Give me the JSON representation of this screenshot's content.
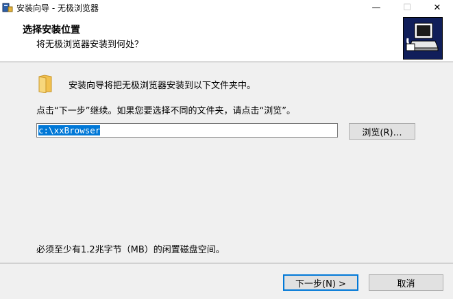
{
  "window": {
    "title": "安装向导 - 无极浏览器",
    "minimize_glyph": "—",
    "maximize_glyph": "☐",
    "close_glyph": "✕"
  },
  "header": {
    "title": "选择安装位置",
    "subtitle": "将无极浏览器安装到何处？",
    "logo_icon": "computer-install-icon"
  },
  "body": {
    "folder_icon": "folder-icon",
    "intro_text": "安装向导将把无极浏览器安装到以下文件夹中。",
    "instruction_text": "点击“下一步”继续。如果您要选择不同的文件夹，请点击“浏览”。",
    "path_value": "c:\\xxBrowser",
    "browse_label": "浏览(R)…",
    "space_requirement": "必须至少有1.2兆字节（MB）的闲置磁盘空间。"
  },
  "footer": {
    "next_label": "下一步(N) >",
    "cancel_label": "取消"
  },
  "colors": {
    "selection": "#0078d7",
    "logo_bg": "#101e5a",
    "folder": "#f2c14e"
  }
}
